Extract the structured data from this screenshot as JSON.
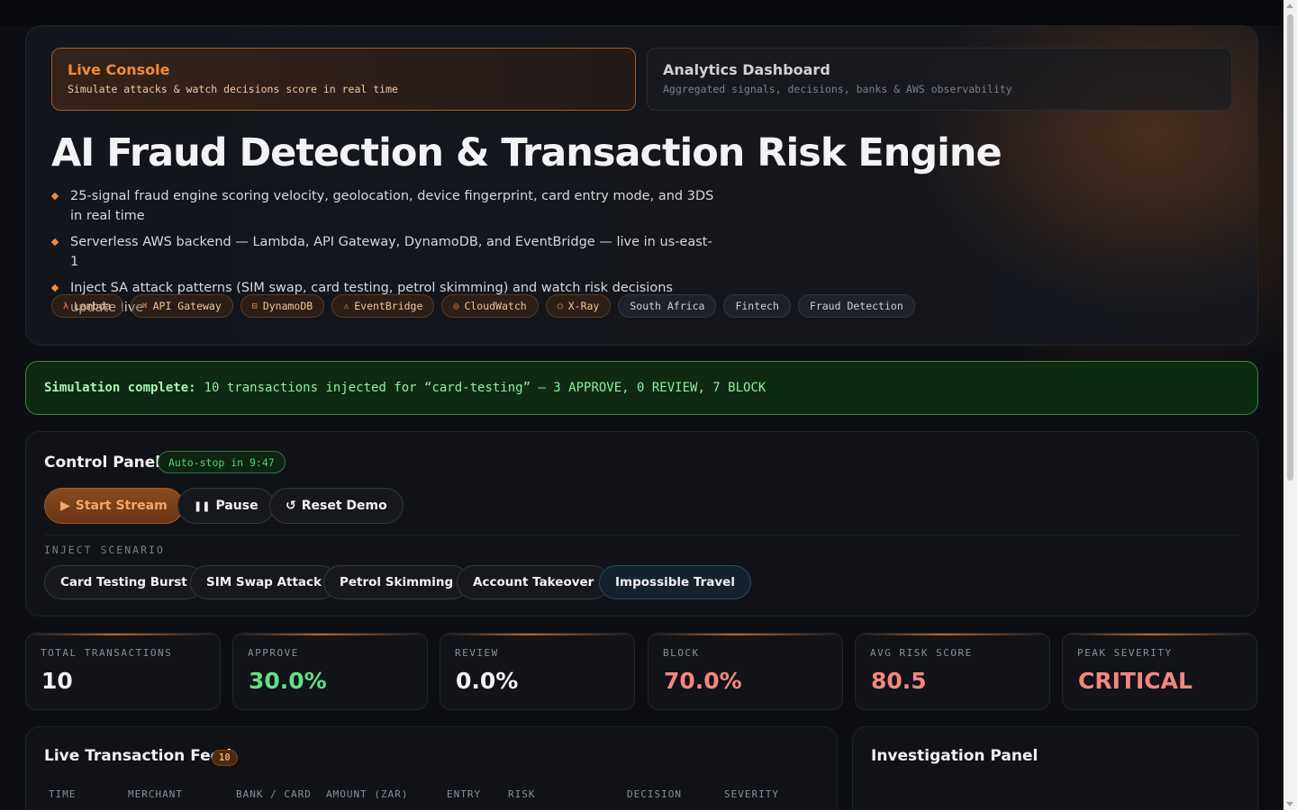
{
  "tabs": {
    "live": {
      "title": "Live Console",
      "subtitle": "Simulate attacks & watch decisions score in real time"
    },
    "analytics": {
      "title": "Analytics Dashboard",
      "subtitle": "Aggregated signals, decisions, banks & AWS observability"
    }
  },
  "hero": {
    "title": "AI Fraud Detection & Transaction Risk Engine",
    "bullets": [
      "25-signal fraud engine scoring velocity, geolocation, device fingerprint, card entry mode, and 3DS in real time",
      "Serverless AWS backend — Lambda, API Gateway, DynamoDB, and EventBridge — live in us-east-1",
      "Inject SA attack patterns (SIM swap, card testing, petrol skimming) and watch risk decisions update live"
    ],
    "tags": [
      {
        "icon": "λ",
        "label": "Lambda"
      },
      {
        "icon": "⌘",
        "label": "API Gateway"
      },
      {
        "icon": "⊟",
        "label": "DynamoDB"
      },
      {
        "icon": "⚠",
        "label": "EventBridge"
      },
      {
        "icon": "◎",
        "label": "CloudWatch"
      },
      {
        "icon": "○",
        "label": "X-Ray"
      },
      {
        "label": "South Africa"
      },
      {
        "label": "Fintech"
      },
      {
        "label": "Fraud Detection"
      }
    ]
  },
  "banner": {
    "strong": "Simulation complete:",
    "text": "10 transactions injected for “card-testing” — 3 APPROVE, 0 REVIEW, 7 BLOCK"
  },
  "control_panel": {
    "title": "Control Panel",
    "autostop": "Auto-stop in 9:47",
    "start_label": "Start Stream",
    "pause_label": "Pause",
    "reset_label": "Reset Demo",
    "inject_label": "INJECT SCENARIO",
    "scenarios": [
      "Card Testing Burst",
      "SIM Swap Attack",
      "Petrol Skimming",
      "Account Takeover",
      "Impossible Travel"
    ]
  },
  "stats": [
    {
      "label": "TOTAL TRANSACTIONS",
      "value": "10",
      "color": "#f3f3f5"
    },
    {
      "label": "APPROVE",
      "value": "30.0%",
      "color": "#5ee08a"
    },
    {
      "label": "REVIEW",
      "value": "0.0%",
      "color": "#f3f3f5"
    },
    {
      "label": "BLOCK",
      "value": "70.0%",
      "color": "#f5867e"
    },
    {
      "label": "AVG RISK SCORE",
      "value": "80.5",
      "color": "#f5867e"
    },
    {
      "label": "PEAK SEVERITY",
      "value": "CRITICAL",
      "color": "#f5867e"
    }
  ],
  "feed": {
    "title": "Live Transaction Feed",
    "count": "10",
    "columns": [
      "TIME",
      "MERCHANT",
      "BANK / CARD",
      "AMOUNT (ZAR)",
      "ENTRY",
      "RISK",
      "DECISION",
      "SEVERITY"
    ]
  },
  "investigation": {
    "title": "Investigation Panel"
  },
  "colors": {
    "accent": "#f08a3c",
    "success": "#5ee08a",
    "danger": "#f5867e"
  }
}
